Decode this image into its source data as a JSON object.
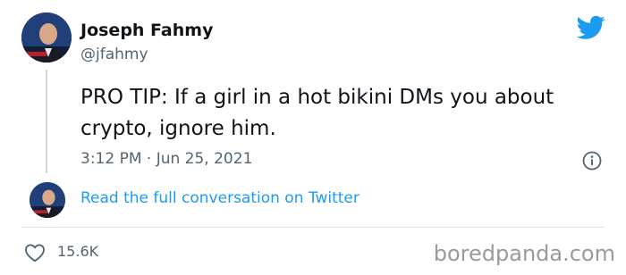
{
  "author": {
    "display_name": "Joseph Fahmy",
    "handle": "@jfahmy"
  },
  "tweet": {
    "text": "PRO TIP: If a girl in a hot bikini DMs you about crypto, ignore him.",
    "timestamp": "3:12 PM · Jun 25, 2021"
  },
  "conversation_link": "Read the full conversation on Twitter",
  "engagement": {
    "likes": "15.6K"
  },
  "watermark": "boredpanda.com",
  "icons": {
    "brand": "twitter-bird-icon",
    "info": "info-icon",
    "like": "heart-icon"
  },
  "colors": {
    "twitter_blue": "#1d9bf0",
    "text_primary": "#0f1419",
    "text_secondary": "#536471"
  }
}
